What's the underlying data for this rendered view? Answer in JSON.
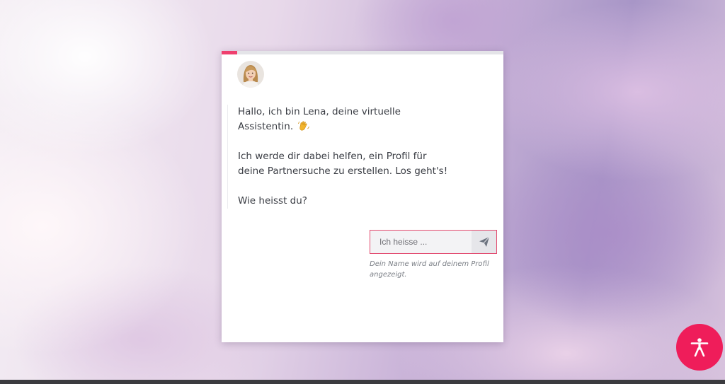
{
  "progress": {
    "fraction": 0.055,
    "color": "#ef3f6e"
  },
  "assistant": {
    "avatar_icon": "woman-avatar"
  },
  "message": {
    "greeting_line1": "Hallo, ich bin Lena, deine virtuelle",
    "greeting_line2": "Assistentin.",
    "greeting_emoji": "waving-hand-icon",
    "help_line1": "Ich werde dir dabei helfen, ein Profil für",
    "help_line2": "deine Partnersuche zu erstellen. Los geht's!",
    "question": "Wie heisst du?"
  },
  "name_form": {
    "value": "",
    "placeholder": "Ich heisse ...",
    "send_icon": "paper-plane-icon",
    "hint": "Dein Name wird auf deinem Profil angezeigt."
  },
  "accessibility": {
    "icon": "accessibility-person-icon",
    "color": "#ef1d5a"
  }
}
